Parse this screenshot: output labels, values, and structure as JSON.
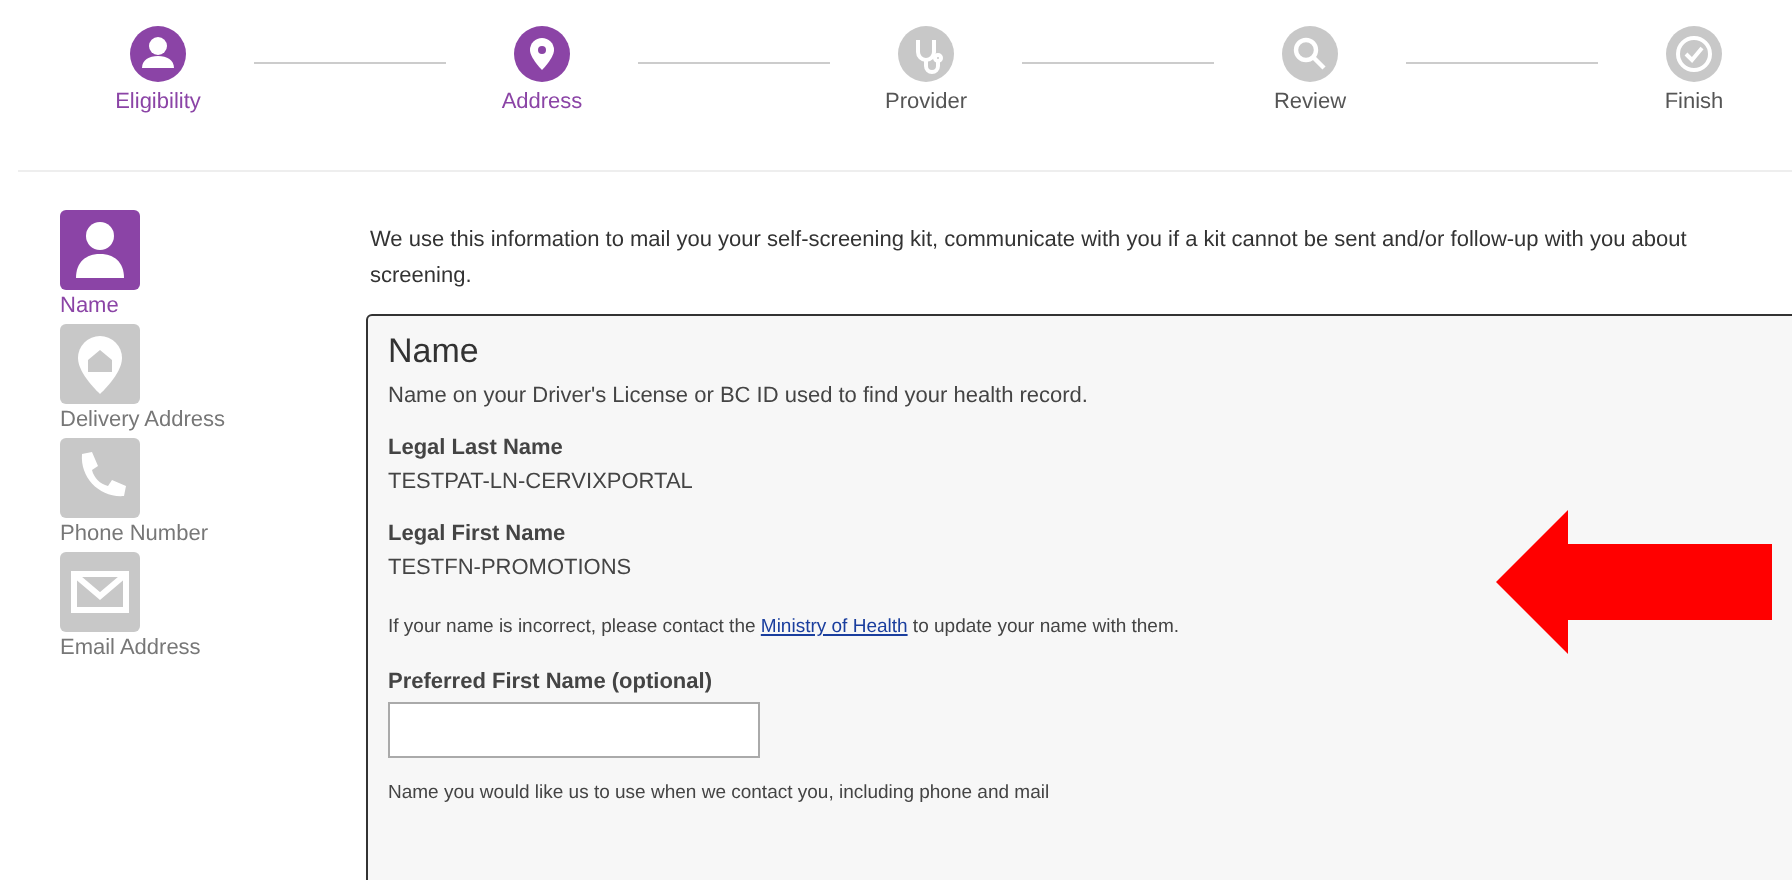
{
  "steps": [
    {
      "label": "Eligibility",
      "active": true
    },
    {
      "label": "Address",
      "active": true
    },
    {
      "label": "Provider",
      "active": false
    },
    {
      "label": "Review",
      "active": false
    },
    {
      "label": "Finish",
      "active": false
    }
  ],
  "sidebar": {
    "items": [
      {
        "label": "Name",
        "selected": true
      },
      {
        "label": "Delivery Address",
        "selected": false
      },
      {
        "label": "Phone Number",
        "selected": false
      },
      {
        "label": "Email Address",
        "selected": false
      }
    ]
  },
  "intro": "We use this information to mail you your self-screening kit, communicate with you if a kit cannot be sent and/or follow-up with you about screening.",
  "card": {
    "title": "Name",
    "subtitle": "Name on your Driver's License or BC ID used to find your health record.",
    "fields": [
      {
        "label": "Legal Last Name",
        "value": "TESTPAT-LN-CERVIXPORTAL"
      },
      {
        "label": "Legal First Name",
        "value": "TESTFN-PROMOTIONS"
      }
    ],
    "note": {
      "before": "If your name is incorrect, please contact the",
      "link": "Ministry of Health",
      "after": "to update your name with them."
    },
    "preferred": {
      "label": "Preferred First Name (optional)",
      "hint": "Name you would like us to use when we contact you, including phone and mail"
    }
  }
}
